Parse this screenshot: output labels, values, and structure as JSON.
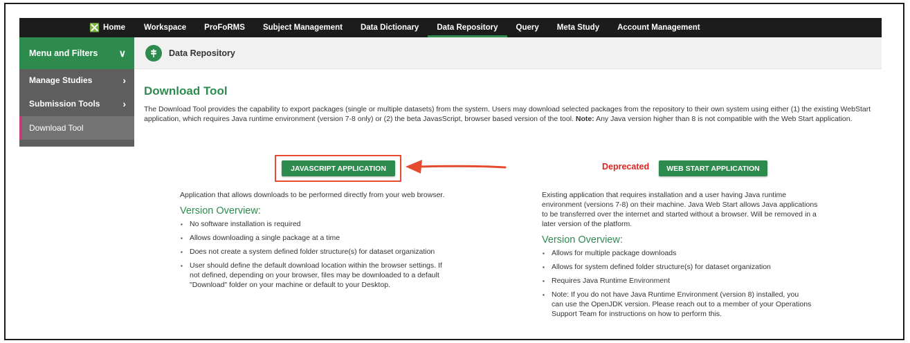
{
  "nav": {
    "home": "Home",
    "items": [
      "Workspace",
      "ProFoRMS",
      "Subject Management",
      "Data Dictionary",
      "Data Repository",
      "Query",
      "Meta Study",
      "Account Management"
    ],
    "active_index": 4
  },
  "sidebar": {
    "header": "Menu and Filters",
    "items": [
      {
        "label": "Manage Studies"
      },
      {
        "label": "Submission Tools"
      },
      {
        "label": "Download Tool"
      }
    ]
  },
  "titlebar": {
    "title": "Data Repository"
  },
  "content": {
    "heading": "Download Tool",
    "desc_part1": "The Download Tool provides the capability to export packages (single or multiple datasets) from the system. Users may download selected packages from the repository to their own system using either (1) the existing WebStart application, which requires Java runtime environment (version 7-8 only) or (2) the beta JavasScript, browser based version of the tool. ",
    "desc_note_label": "Note:",
    "desc_part2": " Any Java version higher than 8 is not compatible with the Web Start application.",
    "left": {
      "button": "JAVASCRIPT APPLICATION",
      "intro": "Application that allows downloads to be performed directly from your web browser.",
      "version_heading": "Version Overview:",
      "bullets": [
        "No software installation is required",
        "Allows downloading a single package at a time",
        "Does not create a system defined folder structure(s) for dataset organization",
        "User should define the default download location within the browser settings. If not defined, depending on your browser, files may be downloaded to a default \"Download\" folder on your machine or default to your Desktop."
      ]
    },
    "right": {
      "deprecated": "Deprecated",
      "button": "WEB START APPLICATION",
      "intro": "Existing application that requires installation and a user having Java runtime environment (versions 7-8) on their machine. Java Web Start allows Java applications to be transferred over the internet and started without a browser. Will be removed in a later version of the platform.",
      "version_heading": "Version Overview:",
      "bullets": [
        "Allows for multiple package downloads",
        "Allows for system defined folder structure(s) for dataset organization",
        "Requires Java Runtime Environment",
        "Note: If you do not have Java Runtime Environment (version 8) installed, you can use the OpenJDK version. Please reach out to a member of your Operations Support Team for instructions on how to perform this."
      ]
    }
  },
  "colors": {
    "accent": "#2e8b4e",
    "nav_bg": "#1c1c1c",
    "sidebar_bg": "#5e5e5e",
    "highlight": "#e44b2f",
    "deprecated": "#e0231f"
  }
}
